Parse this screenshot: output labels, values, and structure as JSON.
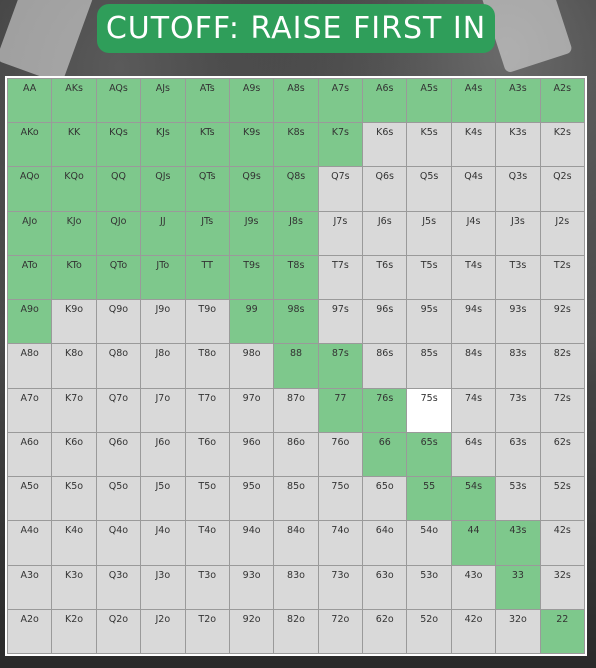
{
  "title": "CUTOFF: RAISE FIRST IN",
  "colors": {
    "raise": "#7ec88c",
    "fold": "#d9d9d9",
    "highlight": "#ffffff",
    "title_bg": "#2f9e5a"
  },
  "ranks": [
    "A",
    "K",
    "Q",
    "J",
    "T",
    "9",
    "8",
    "7",
    "6",
    "5",
    "4",
    "3",
    "2"
  ],
  "hand_grid": [
    [
      "AA",
      "AKs",
      "AQs",
      "AJs",
      "ATs",
      "A9s",
      "A8s",
      "A7s",
      "A6s",
      "A5s",
      "A4s",
      "A3s",
      "A2s"
    ],
    [
      "AKo",
      "KK",
      "KQs",
      "KJs",
      "KTs",
      "K9s",
      "K8s",
      "K7s",
      "K6s",
      "K5s",
      "K4s",
      "K3s",
      "K2s"
    ],
    [
      "AQo",
      "KQo",
      "QQ",
      "QJs",
      "QTs",
      "Q9s",
      "Q8s",
      "Q7s",
      "Q6s",
      "Q5s",
      "Q4s",
      "Q3s",
      "Q2s"
    ],
    [
      "AJo",
      "KJo",
      "QJo",
      "JJ",
      "JTs",
      "J9s",
      "J8s",
      "J7s",
      "J6s",
      "J5s",
      "J4s",
      "J3s",
      "J2s"
    ],
    [
      "ATo",
      "KTo",
      "QTo",
      "JTo",
      "TT",
      "T9s",
      "T8s",
      "T7s",
      "T6s",
      "T5s",
      "T4s",
      "T3s",
      "T2s"
    ],
    [
      "A9o",
      "K9o",
      "Q9o",
      "J9o",
      "T9o",
      "99",
      "98s",
      "97s",
      "96s",
      "95s",
      "94s",
      "93s",
      "92s"
    ],
    [
      "A8o",
      "K8o",
      "Q8o",
      "J8o",
      "T8o",
      "98o",
      "88",
      "87s",
      "86s",
      "85s",
      "84s",
      "83s",
      "82s"
    ],
    [
      "A7o",
      "K7o",
      "Q7o",
      "J7o",
      "T7o",
      "97o",
      "87o",
      "77",
      "76s",
      "75s",
      "74s",
      "73s",
      "72s"
    ],
    [
      "A6o",
      "K6o",
      "Q6o",
      "J6o",
      "T6o",
      "96o",
      "86o",
      "76o",
      "66",
      "65s",
      "64s",
      "63s",
      "62s"
    ],
    [
      "A5o",
      "K5o",
      "Q5o",
      "J5o",
      "T5o",
      "95o",
      "85o",
      "75o",
      "65o",
      "55",
      "54s",
      "53s",
      "52s"
    ],
    [
      "A4o",
      "K4o",
      "Q4o",
      "J4o",
      "T4o",
      "94o",
      "84o",
      "74o",
      "64o",
      "54o",
      "44",
      "43s",
      "42s"
    ],
    [
      "A3o",
      "K3o",
      "Q3o",
      "J3o",
      "T3o",
      "93o",
      "83o",
      "73o",
      "63o",
      "53o",
      "43o",
      "33",
      "32s"
    ],
    [
      "A2o",
      "K2o",
      "Q2o",
      "J2o",
      "T2o",
      "92o",
      "82o",
      "72o",
      "62o",
      "52o",
      "42o",
      "32o",
      "22"
    ]
  ],
  "raise_hands": [
    "AA",
    "AKs",
    "AQs",
    "AJs",
    "ATs",
    "A9s",
    "A8s",
    "A7s",
    "A6s",
    "A5s",
    "A4s",
    "A3s",
    "A2s",
    "AKo",
    "KK",
    "KQs",
    "KJs",
    "KTs",
    "K9s",
    "K8s",
    "K7s",
    "AQo",
    "KQo",
    "QQ",
    "QJs",
    "QTs",
    "Q9s",
    "Q8s",
    "AJo",
    "KJo",
    "QJo",
    "JJ",
    "JTs",
    "J9s",
    "J8s",
    "ATo",
    "KTo",
    "QTo",
    "JTo",
    "TT",
    "T9s",
    "T8s",
    "A9o",
    "99",
    "98s",
    "88",
    "87s",
    "77",
    "76s",
    "66",
    "65s",
    "55",
    "54s",
    "44",
    "43s",
    "33",
    "22"
  ],
  "highlight_hands": [
    "75s"
  ]
}
